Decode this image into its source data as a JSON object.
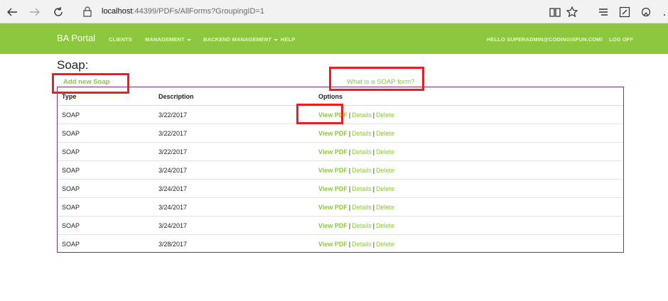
{
  "browser": {
    "url_host": "localhost",
    "url_path": ":44399/PDFs/AllForms?GroupingID=1"
  },
  "navbar": {
    "brand": "BA Portal",
    "links": [
      "CLIENTS",
      "MANAGEMENT",
      "BACKEND MANAGEMENT",
      "HELP"
    ],
    "user": "HELLO SUPERADMIN@CODINGISFUN.COM!",
    "logoff": "LOG OFF",
    "color": "#8dc63f"
  },
  "page": {
    "title": "Soap:",
    "add_link": "Add new Soap",
    "what_link": "What is a SOAP form?"
  },
  "table": {
    "headers": [
      "Type",
      "Description",
      "Options"
    ],
    "option_labels": {
      "view": "View PDF",
      "details": "Details",
      "delete": "Delete",
      "sep": "|"
    },
    "rows": [
      {
        "type": "SOAP",
        "description": "3/22/2017"
      },
      {
        "type": "SOAP",
        "description": "3/22/2017"
      },
      {
        "type": "SOAP",
        "description": "3/22/2017"
      },
      {
        "type": "SOAP",
        "description": "3/24/2017"
      },
      {
        "type": "SOAP",
        "description": "3/24/2017"
      },
      {
        "type": "SOAP",
        "description": "3/24/2017"
      },
      {
        "type": "SOAP",
        "description": "3/24/2017"
      },
      {
        "type": "SOAP",
        "description": "3/28/2017"
      }
    ]
  },
  "colors": {
    "accent": "#8dc63f",
    "highlight": "#ee1d24",
    "table_border": "#8a2a8a"
  }
}
